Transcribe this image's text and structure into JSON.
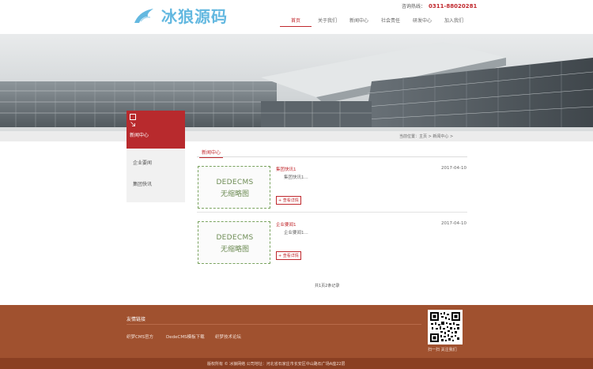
{
  "header": {
    "logo_text": "冰狼源码",
    "hotline_label": "咨询热线：",
    "hotline_number": "0311-88020281"
  },
  "nav": {
    "items": [
      {
        "label": "首页"
      },
      {
        "label": "关于我们"
      },
      {
        "label": "新闻中心"
      },
      {
        "label": "社会责任"
      },
      {
        "label": "研发中心"
      },
      {
        "label": "加入我们"
      }
    ]
  },
  "breadcrumb": {
    "text": "当前位置：主页 > 新闻中心 >"
  },
  "sidebar": {
    "title": "新闻中心",
    "items": [
      {
        "label": "企业要闻"
      },
      {
        "label": "集团快讯"
      }
    ]
  },
  "content": {
    "section_title": "新闻中心",
    "articles": [
      {
        "thumb_line1": "DEDECMS",
        "thumb_line2": "无缩略图",
        "title": "集团快讯1",
        "date": "2017-04-10",
        "desc": "集团快讯1...",
        "more": "+ 查看详情"
      },
      {
        "thumb_line1": "DEDECMS",
        "thumb_line2": "无缩略图",
        "title": "企业要闻1",
        "date": "2017-04-10",
        "desc": "企业要闻1...",
        "more": "+ 查看详情"
      }
    ],
    "pager": "共1页2条记录"
  },
  "footer": {
    "links_title": "友情链接",
    "links": [
      {
        "label": "织梦CMS官方"
      },
      {
        "label": "DedeCMS模板下载"
      },
      {
        "label": "织梦技术论坛"
      }
    ],
    "qr_label": "扫一扫 关注我们",
    "copyright": "版权所有 © 冰狼网络   公司地址：河北省石家庄市长安区中山路石广场A座22层"
  },
  "colors": {
    "accent": "#c0282d",
    "logo": "#63b8e0",
    "footer_bg": "#a0512f",
    "footer_bottom": "#8a3f22"
  }
}
